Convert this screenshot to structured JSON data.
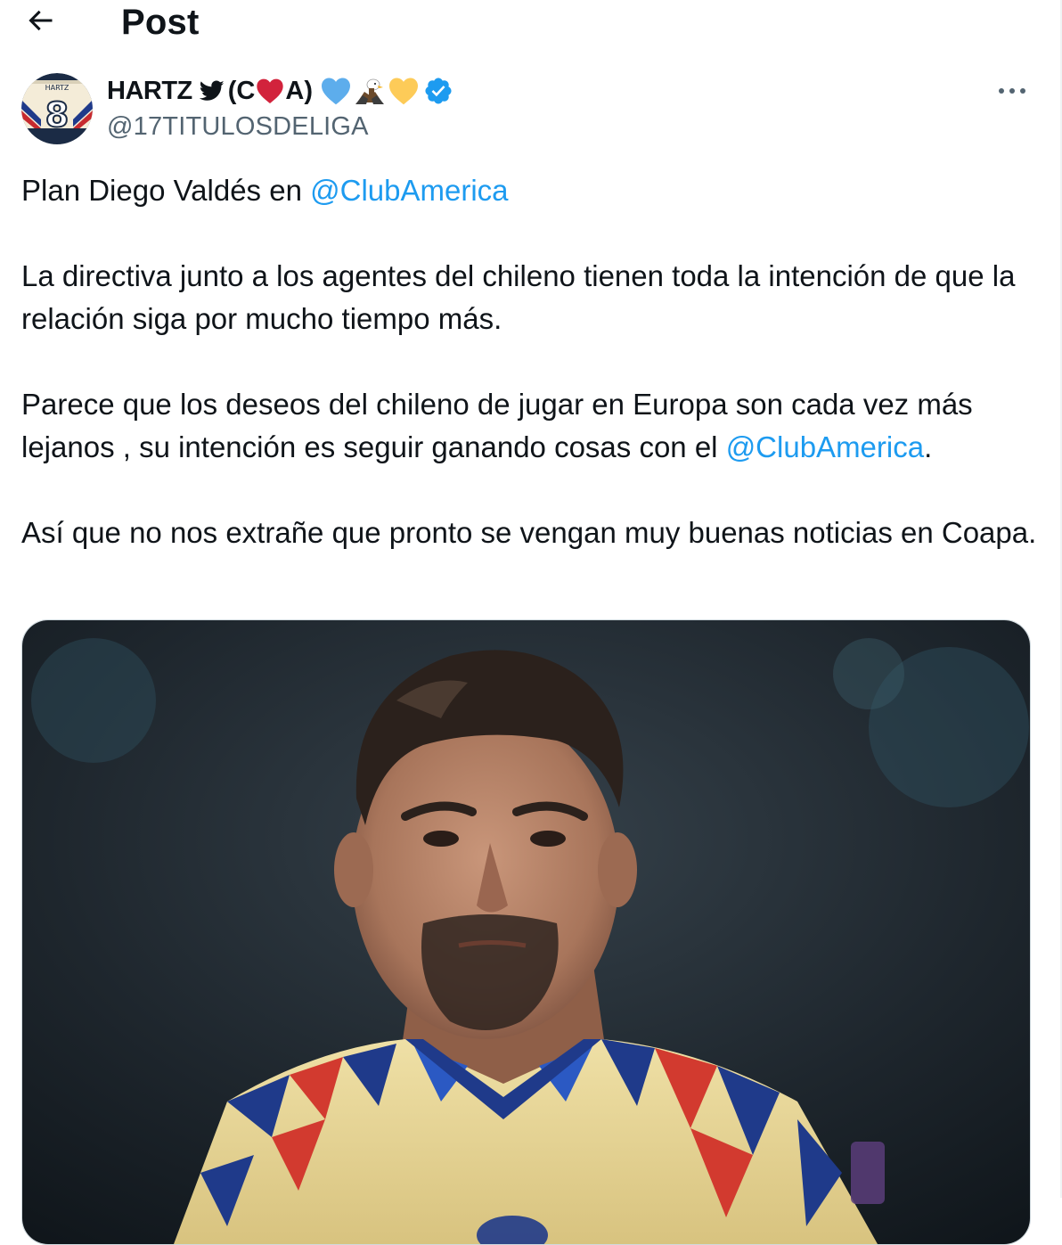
{
  "header": {
    "back_icon": "arrow-left-icon",
    "title": "Post"
  },
  "author": {
    "avatar_icon": "avatar-jersey-8",
    "avatar_text": "HARTZ",
    "avatar_number": "8",
    "display_name_text": "HARTZ",
    "display_name_paren_open": "(C",
    "display_name_paren_close": "A)",
    "name_icons": [
      "bird-icon",
      "red-heart-icon",
      "blue-heart-icon",
      "eagle-icon",
      "yellow-heart-icon",
      "verified-badge-icon"
    ],
    "handle": "@17TITULOSDELIGA",
    "more_icon": "more-horizontal-icon"
  },
  "tweet": {
    "p1_text": "Plan Diego Valdés en ",
    "p1_mention": "@ClubAmerica",
    "p2_text": "La directiva junto a los agentes del chileno tienen toda la intención de que la relación siga por mucho tiempo más.",
    "p3_text": "Parece que los deseos del chileno de jugar en Europa son cada vez más lejanos , su intención es seguir ganando cosas con el ",
    "p3_mention": "@ClubAmerica",
    "p3_end": ".",
    "p4_text": "Así que no nos extrañe que pronto se vengan muy buenas noticias en Coapa."
  },
  "media": {
    "kind": "photo",
    "subject": "player-portrait"
  },
  "colors": {
    "text": "#0f1419",
    "secondary": "#536471",
    "link": "#1d9bf0",
    "verified": "#1d9bf0",
    "border": "#cfd9de"
  }
}
